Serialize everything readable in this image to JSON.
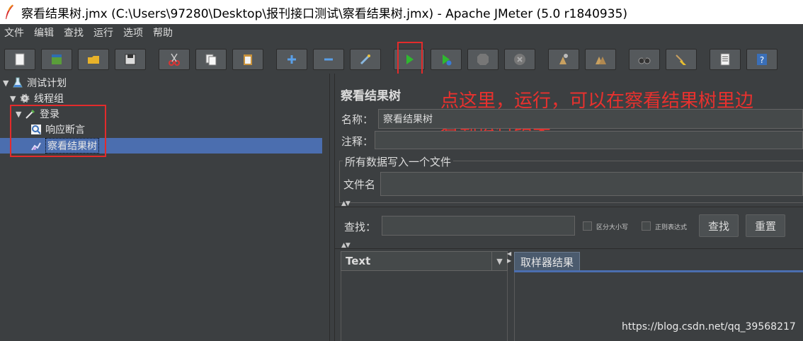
{
  "window": {
    "title": "察看结果树.jmx (C:\\Users\\97280\\Desktop\\报刊接口测试\\察看结果树.jmx) - Apache JMeter (5.0 r1840935)"
  },
  "menu": [
    "文件",
    "编辑",
    "查找",
    "运行",
    "选项",
    "帮助"
  ],
  "toolbar": {
    "icons": [
      "new-icon",
      "templates-icon",
      "open-icon",
      "save-icon",
      "cut-icon",
      "copy-icon",
      "paste-icon",
      "expand-icon",
      "collapse-icon",
      "toggle-icon",
      "start-icon",
      "start-no-pause-icon",
      "stop-icon",
      "shutdown-icon",
      "clear-icon",
      "clear-all-icon",
      "search-icon",
      "reset-search-icon",
      "function-helper-icon",
      "help-icon"
    ]
  },
  "tree": {
    "items": [
      {
        "label": "测试计划",
        "icon": "test-plan-icon"
      },
      {
        "label": "线程组",
        "icon": "thread-group-icon"
      },
      {
        "label": "登录",
        "icon": "sampler-icon"
      },
      {
        "label": "响应断言",
        "icon": "assertion-icon"
      },
      {
        "label": "察看结果树",
        "icon": "listener-icon"
      }
    ]
  },
  "panel": {
    "title": "察看结果树",
    "name_label": "名称：",
    "name_value": "察看结果树",
    "comment_label": "注释：",
    "comment_value": "",
    "file_group_title": "所有数据写入一个文件",
    "file_label": "文件名",
    "search_label": "查找：",
    "case_sensitive_label": "区分大小写",
    "regex_label": "正则表达式",
    "search_button": "查找",
    "reset_button": "重置",
    "renderer_value": "Text",
    "tab_label": "取样器结果"
  },
  "annotation": {
    "line1": "点这里，运行，可以在察看结果树里边",
    "line2": "看到运行结果"
  },
  "watermark": "https://blog.csdn.net/qq_39568217",
  "colors": {
    "highlight_red": "#e32b2b",
    "selection_blue": "#4b6eaf",
    "background": "#3c3f41"
  }
}
